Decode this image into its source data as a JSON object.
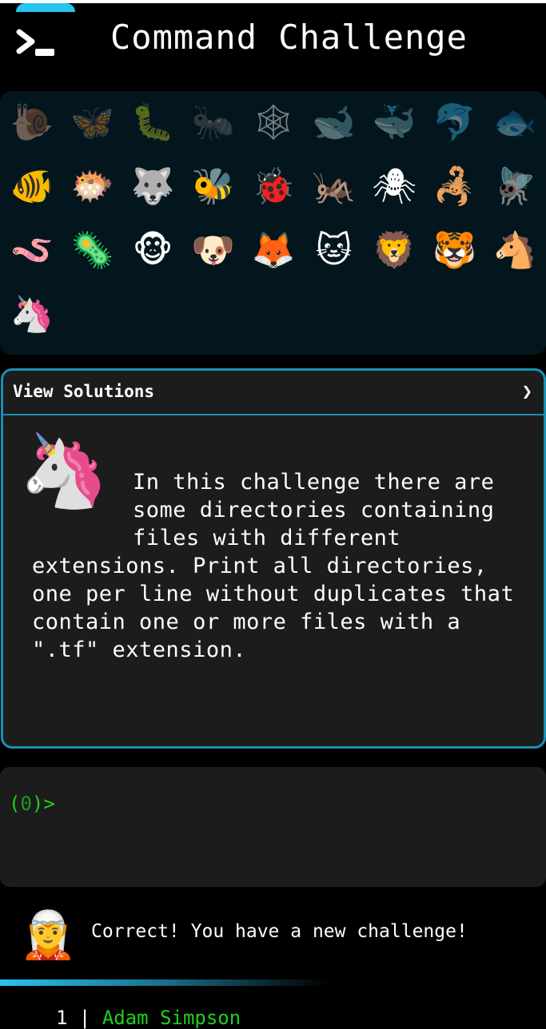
{
  "header": {
    "title": "Command Challenge",
    "logo_icon": "terminal-prompt-icon",
    "accent": "#29c4ee"
  },
  "challenges": [
    {
      "emoji": "🐌",
      "icon": "snail-icon",
      "locked": true
    },
    {
      "emoji": "🦋",
      "icon": "butterfly-icon",
      "locked": true
    },
    {
      "emoji": "🐛",
      "icon": "caterpillar-icon",
      "locked": true
    },
    {
      "emoji": "🐜",
      "icon": "ant-icon",
      "locked": true
    },
    {
      "emoji": "🕸",
      "icon": "spider-web-icon",
      "locked": true
    },
    {
      "emoji": "🐋",
      "icon": "whale-icon",
      "locked": true
    },
    {
      "emoji": "🐳",
      "icon": "spouting-whale-icon",
      "locked": true
    },
    {
      "emoji": "🐬",
      "icon": "dolphin-icon",
      "locked": true
    },
    {
      "emoji": "🐟",
      "icon": "fish-icon",
      "locked": true
    },
    {
      "emoji": "🐠",
      "icon": "tropical-fish-icon",
      "locked": false
    },
    {
      "emoji": "🐡",
      "icon": "blowfish-icon",
      "locked": false
    },
    {
      "emoji": "🐺",
      "icon": "wolf-icon",
      "locked": false
    },
    {
      "emoji": "🐝",
      "icon": "bee-icon",
      "locked": false
    },
    {
      "emoji": "🐞",
      "icon": "ladybug-icon",
      "locked": false
    },
    {
      "emoji": "🦗",
      "icon": "cricket-icon",
      "locked": false
    },
    {
      "emoji": "🕷",
      "icon": "spider-icon",
      "locked": false
    },
    {
      "emoji": "🦂",
      "icon": "scorpion-icon",
      "locked": false
    },
    {
      "emoji": "🪰",
      "icon": "fly-icon",
      "locked": false
    },
    {
      "emoji": "🪱",
      "icon": "worm-icon",
      "locked": false
    },
    {
      "emoji": "🦠",
      "icon": "microbe-icon",
      "locked": false
    },
    {
      "emoji": "🐵",
      "icon": "monkey-icon",
      "locked": false
    },
    {
      "emoji": "🐶",
      "icon": "dog-icon",
      "locked": false
    },
    {
      "emoji": "🦊",
      "icon": "fox-icon",
      "locked": false
    },
    {
      "emoji": "🐱",
      "icon": "cat-icon",
      "locked": false
    },
    {
      "emoji": "🦁",
      "icon": "lion-icon",
      "locked": false
    },
    {
      "emoji": "🐯",
      "icon": "tiger-icon",
      "locked": false
    },
    {
      "emoji": "🐴",
      "icon": "horse-icon",
      "locked": false
    },
    {
      "emoji": "🦄",
      "icon": "unicorn-icon",
      "locked": false
    }
  ],
  "panel": {
    "header_label": "View Solutions",
    "chevron": "❯",
    "icon_emoji": "🦄",
    "description": "In this challenge there are some directories containing files with different extensions. Print all directories, one per line without duplicates that contain one or more files with a \".tf\" extension."
  },
  "terminal": {
    "prompt_open": "(",
    "prompt_count": "0",
    "prompt_close": ")>"
  },
  "message": {
    "avatar_emoji": "🧝",
    "text": "Correct! You have a new challenge!"
  },
  "leaderboard": [
    {
      "rank": "1",
      "name": "Adam Simpson"
    }
  ]
}
